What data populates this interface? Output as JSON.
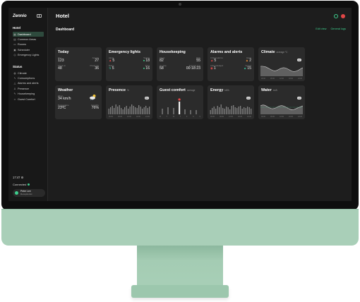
{
  "app": {
    "brand": "Zennio",
    "page_title": "Hotel"
  },
  "sidebar": {
    "section_hotel": "Hotel",
    "hotel_items": [
      {
        "label": "Dashboard",
        "icon": "grid-icon",
        "active": true
      },
      {
        "label": "Common Areas",
        "icon": "building-icon"
      },
      {
        "label": "Rooms",
        "icon": "bed-icon"
      },
      {
        "label": "Scheduler",
        "icon": "calendar-icon"
      },
      {
        "label": "Emergency Lights",
        "icon": "bulb-icon"
      }
    ],
    "section_status": "Status",
    "status_items": [
      {
        "label": "Climate",
        "icon": "thermometer-icon"
      },
      {
        "label": "Consumptions",
        "icon": "bolt-icon"
      },
      {
        "label": "Alarms and alerts",
        "icon": "alert-icon"
      },
      {
        "label": "Presence",
        "icon": "person-icon"
      },
      {
        "label": "Housekeeping",
        "icon": "broom-icon"
      },
      {
        "label": "Guest Comfort",
        "icon": "smile-icon"
      }
    ],
    "clock": "17:47",
    "connection": "Connected",
    "user_name": "Peter Lee",
    "user_role": "Receptionist"
  },
  "dashboard": {
    "title": "Dashboard",
    "edit_view": "Edit view",
    "general_logs": "General logs"
  },
  "cards": {
    "today": {
      "title": "Today",
      "l1": "Occ.",
      "v1": "123",
      "l2": "Arrivals",
      "v2": "27",
      "l3": "Check-in",
      "v3": "48",
      "l4": "Check-out",
      "v4": "36"
    },
    "emergency": {
      "title": "Emergency lights",
      "l1": "Alerts",
      "v1": "5",
      "l2": "Testing",
      "v2": "18",
      "l3": "Mains",
      "v3": "5",
      "l4": "Pass",
      "v4": "16"
    },
    "housekeeping": {
      "title": "Housekeeping",
      "l1": "Clean",
      "v1": "82",
      "l2": "Dirty",
      "v2": "55",
      "l3": "On duty",
      "v3": "58",
      "l4": "Average time",
      "v4": "00:18:23"
    },
    "alarms": {
      "title": "Alarms and alerts",
      "l1": "Critical alarms",
      "v1": "5",
      "l2": "Alerts",
      "v2": "2",
      "l3": "Acknowledged",
      "v3": "1",
      "l4": "Solved",
      "v4": "15"
    },
    "climate": {
      "title": "Climate",
      "sub": "average °C",
      "badge": "22",
      "ticks": [
        "00:00",
        "06:00",
        "12:00",
        "18:00",
        "24:00"
      ]
    },
    "weather": {
      "title": "Weather",
      "l1": "Wind",
      "v1": "34 km/h",
      "l2": "Temperature",
      "v2": "23ºC",
      "l3": "Humidity",
      "v3": "76%"
    },
    "presence": {
      "title": "Presence",
      "sub": "%",
      "badge": "82",
      "ticks": [
        "00:00",
        "06:00",
        "12:00",
        "18:00",
        "24:00"
      ]
    },
    "guest_comfort": {
      "title": "Guest comfort",
      "sub": "average",
      "ticks": [
        "M",
        "T",
        "W",
        "T",
        "F",
        "S",
        "S"
      ]
    },
    "energy": {
      "title": "Energy",
      "sub": "kWh",
      "badge": "14",
      "ticks": [
        "00:00",
        "06:00",
        "12:00",
        "18:00",
        "24:00"
      ]
    },
    "water": {
      "title": "Water",
      "sub": "m³/h",
      "badge": "10",
      "ticks": [
        "00:00",
        "06:00",
        "12:00",
        "18:00",
        "24:00"
      ]
    }
  },
  "colors": {
    "accent": "#3ecf8e",
    "alert_red": "#e64a4a",
    "warning_orange": "#f0913a",
    "chin": "#a9cfb8"
  }
}
